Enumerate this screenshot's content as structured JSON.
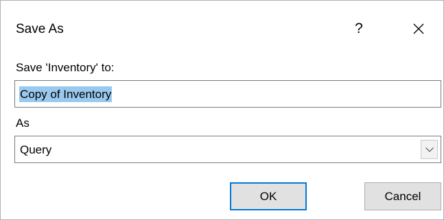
{
  "dialog": {
    "title": "Save As",
    "help_label": "?",
    "close_icon": "close-icon"
  },
  "save_to": {
    "label": "Save 'Inventory' to:",
    "value": "Copy of Inventory"
  },
  "as": {
    "label": "As",
    "selected": "Query",
    "dropdown_icon": "chevron-down-icon"
  },
  "buttons": {
    "ok_label": "OK",
    "cancel_label": "Cancel"
  },
  "colors": {
    "selection_highlight": "#99c9ef",
    "default_button_border": "#0078d7"
  }
}
